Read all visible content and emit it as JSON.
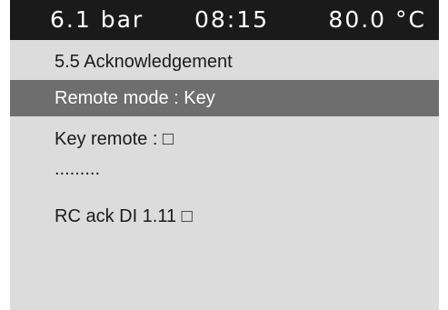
{
  "status_bar": {
    "pressure": "6.1 bar",
    "time": "08:15",
    "temperature": "80.0 °C"
  },
  "menu": {
    "title": "5.5 Acknowledgement",
    "items": [
      {
        "label": "Remote mode : Key",
        "selected": true
      },
      {
        "label": "Key remote : □",
        "selected": false
      },
      {
        "label": ".........",
        "selected": false
      },
      {
        "label": "RC ack DI 1.11 □",
        "selected": false
      }
    ]
  },
  "colors": {
    "status_bar_bg": "#1a1a1a",
    "screen_bg": "#dcdcdc",
    "selection_bg": "#6e6e6e"
  }
}
